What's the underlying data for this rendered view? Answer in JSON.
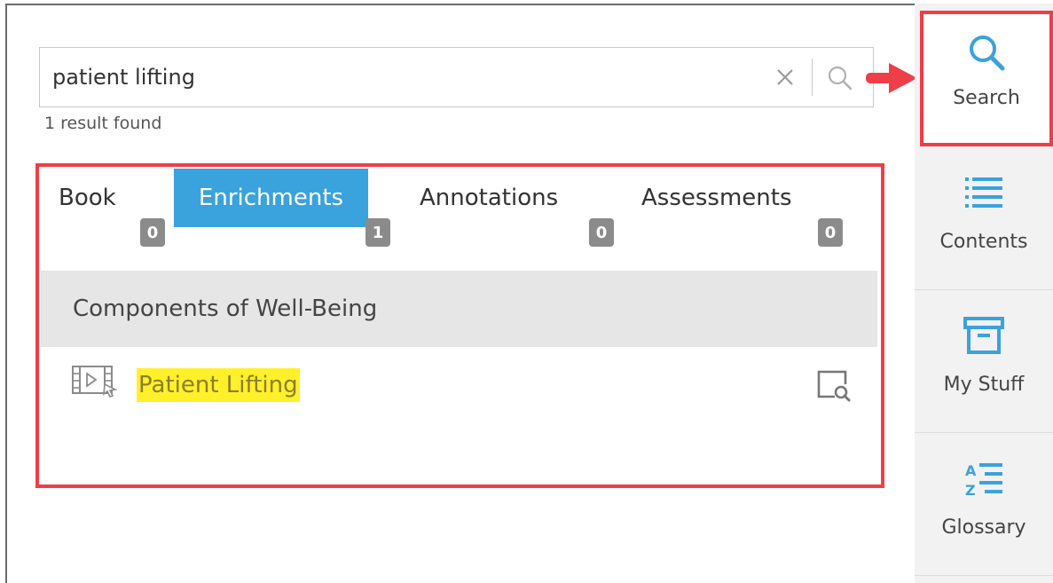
{
  "search": {
    "query": "patient lifting",
    "result_count_text": "1 result found",
    "clear_icon": "close-icon",
    "submit_icon": "search-icon"
  },
  "tabs": [
    {
      "label": "Book",
      "count": "0",
      "active": false
    },
    {
      "label": "Enrichments",
      "count": "1",
      "active": true
    },
    {
      "label": "Annotations",
      "count": "0",
      "active": false
    },
    {
      "label": "Assessments",
      "count": "0",
      "active": false
    }
  ],
  "results": {
    "section_title": "Components of Well-Being",
    "items": [
      {
        "title": "Patient Lifting",
        "type_icon": "video-icon",
        "action_icon": "preview-icon"
      }
    ]
  },
  "sidebar": {
    "items": [
      {
        "label": "Search",
        "icon": "search-icon",
        "active": true
      },
      {
        "label": "Contents",
        "icon": "list-icon",
        "active": false
      },
      {
        "label": "My Stuff",
        "icon": "archive-box-icon",
        "active": false
      },
      {
        "label": "Glossary",
        "icon": "glossary-az-icon",
        "active": false
      }
    ]
  },
  "colors": {
    "accent_blue": "#3aa2dd",
    "highlight_red": "#ef3e48",
    "match_highlight": "#fff02a",
    "badge_gray": "#8b8b8b",
    "section_bg": "#e6e6e6",
    "sidebar_bg": "#f2f2f2"
  }
}
